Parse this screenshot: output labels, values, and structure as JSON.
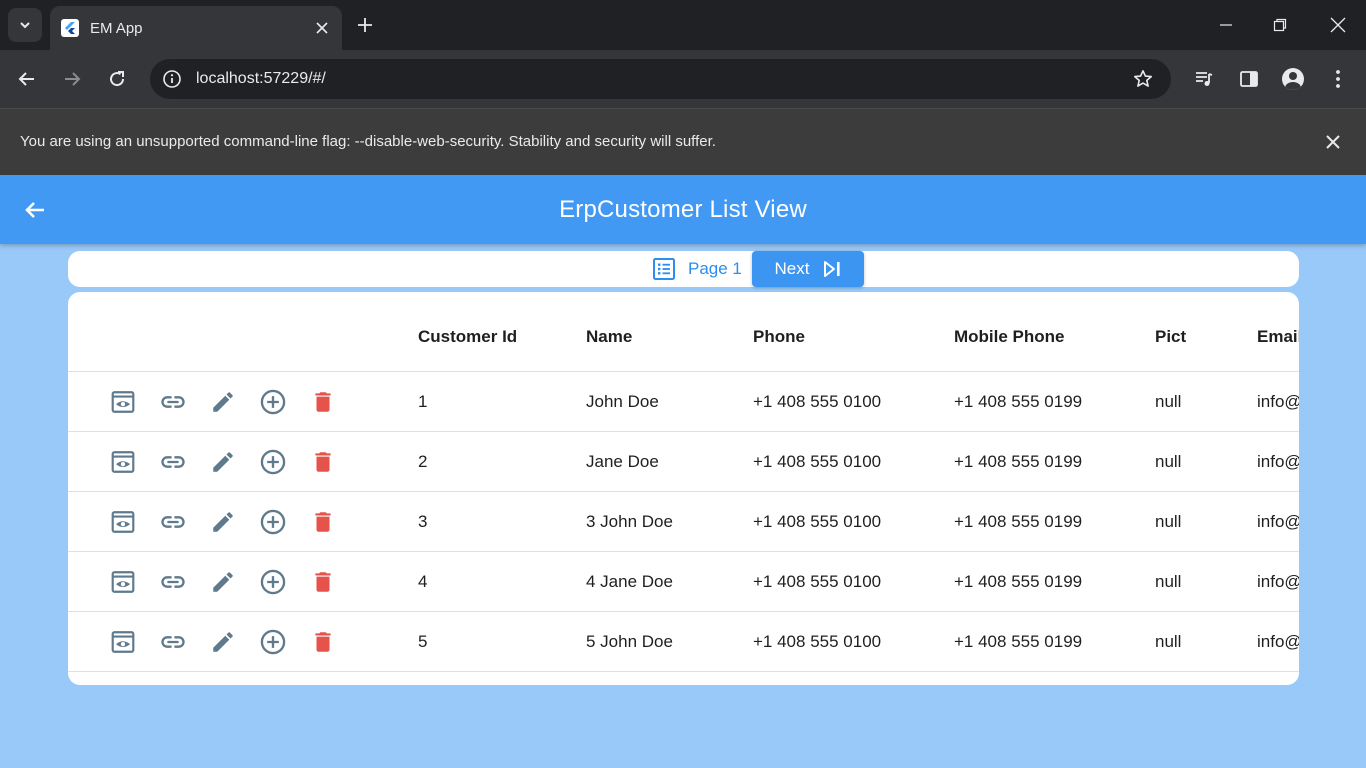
{
  "browser": {
    "tab_title": "EM App",
    "url": "localhost:57229/#/",
    "infobar_message": "You are using an unsupported command-line flag: --disable-web-security. Stability and security will suffer."
  },
  "app": {
    "title": "ErpCustomer List View",
    "pager": {
      "page_label": "Page 1",
      "next_label": "Next"
    },
    "table": {
      "columns": [
        "Customer Id",
        "Name",
        "Phone",
        "Mobile Phone",
        "Pict",
        "Email"
      ],
      "rows": [
        {
          "id": "1",
          "name": "John Doe",
          "phone": "+1 408 555 0100",
          "mobile": "+1 408 555 0199",
          "pict": "null",
          "email": "info@"
        },
        {
          "id": "2",
          "name": "Jane Doe",
          "phone": "+1 408 555 0100",
          "mobile": "+1 408 555 0199",
          "pict": "null",
          "email": "info@"
        },
        {
          "id": "3",
          "name": "3 John Doe",
          "phone": "+1 408 555 0100",
          "mobile": "+1 408 555 0199",
          "pict": "null",
          "email": "info@"
        },
        {
          "id": "4",
          "name": "4 Jane Doe",
          "phone": "+1 408 555 0100",
          "mobile": "+1 408 555 0199",
          "pict": "null",
          "email": "info@"
        },
        {
          "id": "5",
          "name": "5 John Doe",
          "phone": "+1 408 555 0100",
          "mobile": "+1 408 555 0199",
          "pict": "null",
          "email": "info@"
        }
      ],
      "row_actions": [
        "view-icon",
        "link-icon",
        "edit-icon",
        "add-circle-icon",
        "delete-icon"
      ]
    }
  },
  "colors": {
    "appbar": "#4299f3",
    "background": "#99c9f8",
    "action_icon": "#5f7a8c",
    "delete_icon": "#e5534b",
    "pager_accent": "#2b8ef0"
  }
}
